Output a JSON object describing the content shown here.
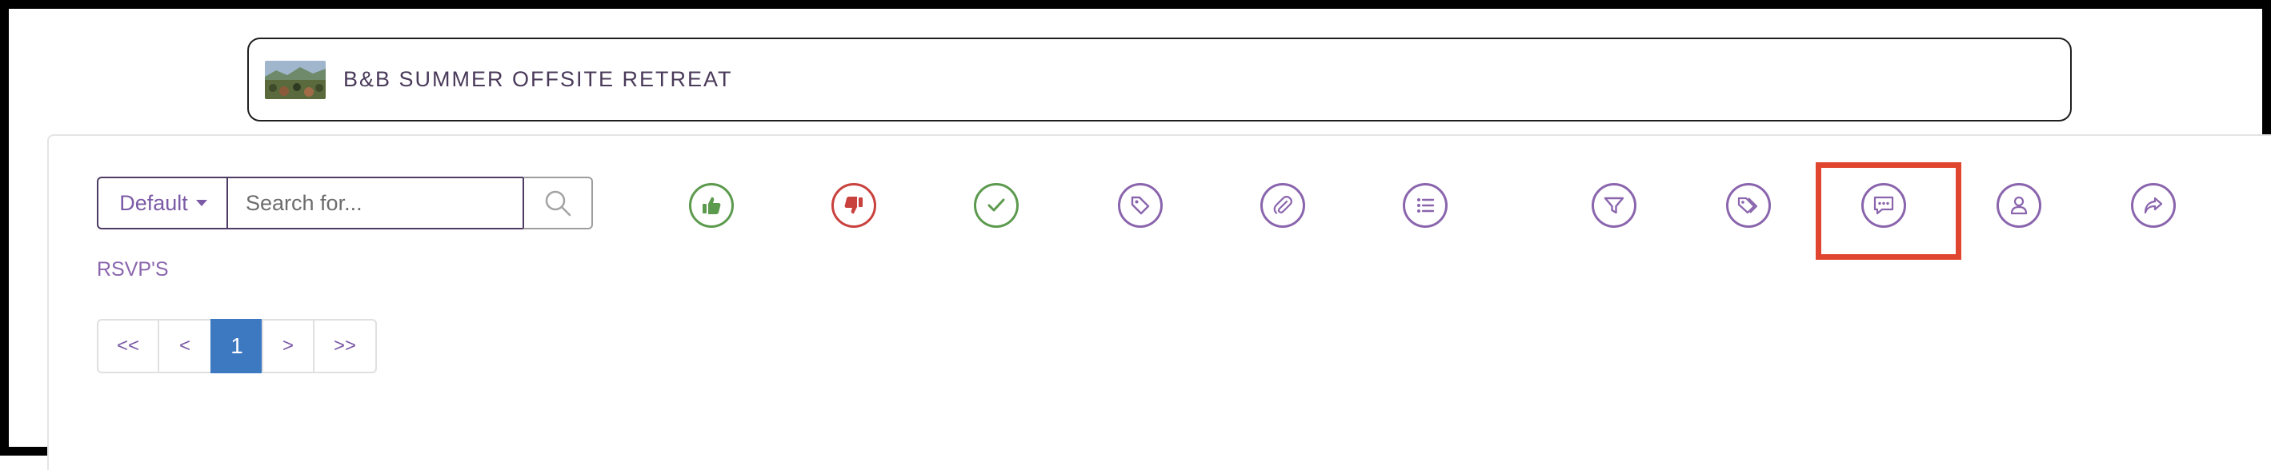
{
  "event": {
    "title": "B&B SUMMER OFFSITE RETREAT"
  },
  "toolbar": {
    "sort_label": "Default",
    "search_placeholder": "Search for..."
  },
  "icons": [
    {
      "name": "thumbs-up-icon",
      "color": "#5c9a4e"
    },
    {
      "name": "thumbs-down-icon",
      "color": "#c9413d"
    },
    {
      "name": "check-icon",
      "color": "#5c9a4e"
    },
    {
      "name": "tag-icon",
      "color": "#8a65ad"
    },
    {
      "name": "paperclip-icon",
      "color": "#8a65ad"
    },
    {
      "name": "list-icon",
      "color": "#8a65ad"
    },
    {
      "name": "filter-icon",
      "color": "#8a65ad"
    },
    {
      "name": "tags-icon",
      "color": "#8a65ad"
    },
    {
      "name": "comment-icon",
      "color": "#8a65ad"
    },
    {
      "name": "user-icon",
      "color": "#8a65ad"
    },
    {
      "name": "share-icon",
      "color": "#8a65ad"
    }
  ],
  "highlighted_icon": "comment-icon",
  "section": {
    "label": "RSVP'S"
  },
  "pagination": {
    "first": "<<",
    "prev": "<",
    "current": "1",
    "next": ">",
    "last": ">>"
  },
  "colors": {
    "accent": "#8a65ad",
    "active_page": "#3c79c1",
    "highlight": "#e0462f"
  }
}
